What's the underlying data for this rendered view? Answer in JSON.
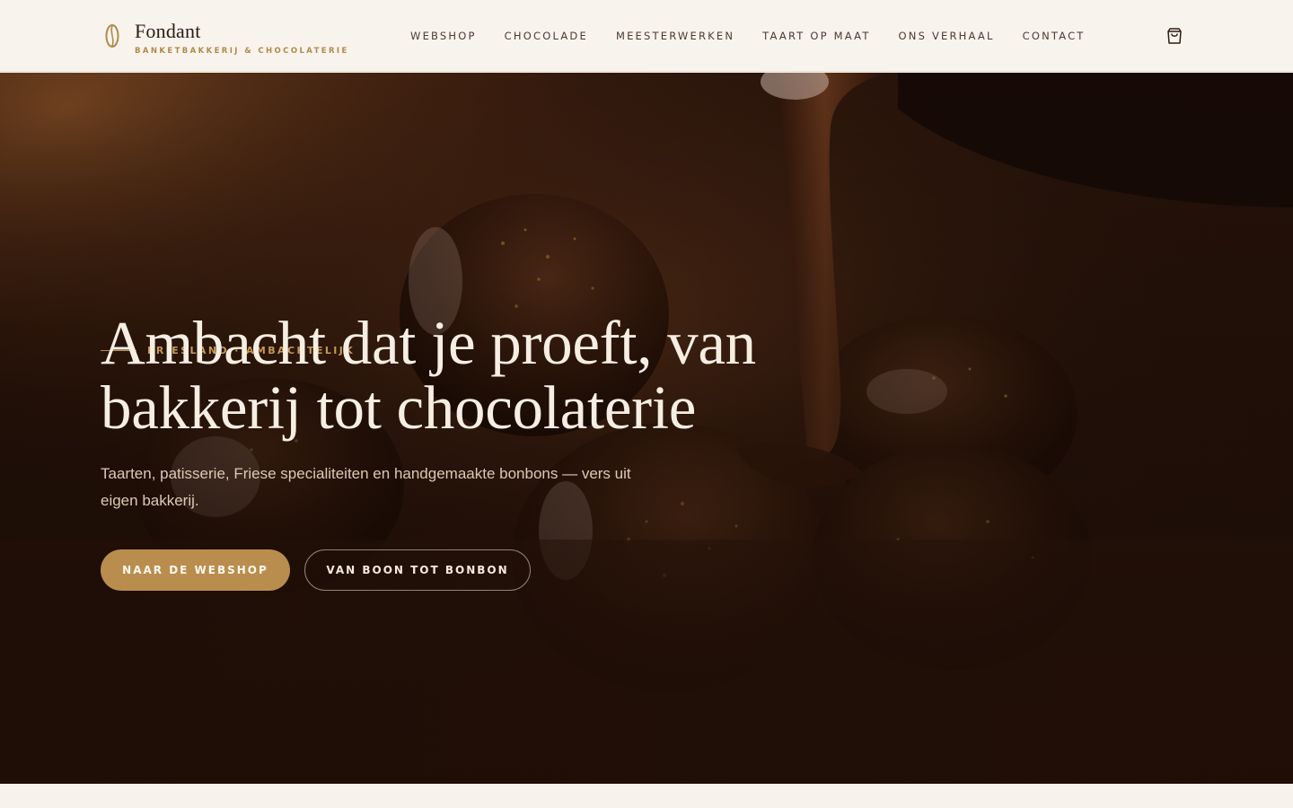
{
  "brand": {
    "name": "Fondant",
    "tagline": "BANKETBAKKERIJ & CHOCOLATERIE",
    "icon": "cacao-bean-icon"
  },
  "nav": {
    "items": [
      {
        "label": "WEBSHOP"
      },
      {
        "label": "CHOCOLADE"
      },
      {
        "label": "MEESTERWERKEN"
      },
      {
        "label": "TAART OP MAAT"
      },
      {
        "label": "ONS VERHAAL"
      },
      {
        "label": "CONTACT"
      }
    ],
    "cart_icon": "shopping-bag-icon"
  },
  "hero": {
    "eyebrow": "FRIESLAND · AMBACHTELIJK",
    "title_line1": "Ambacht dat je proeft, van",
    "title_line2": "bakkerij tot chocolaterie",
    "subtitle": "Taarten, patisserie, Friese specialiteiten en handgemaakte bonbons — vers uit eigen bakkerij.",
    "primary_button": "NAAR DE WEBSHOP",
    "secondary_button": "VAN BOON TOT BONBON"
  },
  "colors": {
    "accent": "#b98d4e",
    "header_bg": "#f8f4ed",
    "hero_dark": "#2a150b",
    "hero_text": "#f6eee2"
  }
}
